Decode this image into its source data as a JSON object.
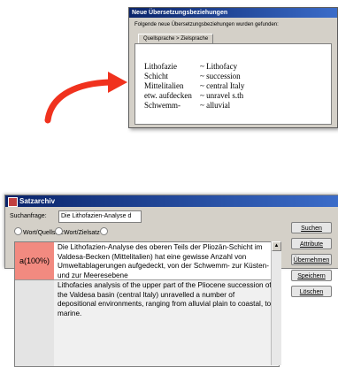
{
  "dialog": {
    "title": "Neue Übersetzungsbeziehungen",
    "message": "Folgende neue Übersetzungsbeziehungen wurden gefunden:",
    "tab": "Quellsprache > Zielsprache",
    "rows": [
      {
        "source": "Lithofazie",
        "target": "~ Lithofacy"
      },
      {
        "source": "Schicht",
        "target": "~ succession"
      },
      {
        "source": "Mittelitalien",
        "target": "~ central Italy"
      },
      {
        "source": "etw. aufdecken",
        "target": "~ unravel s.th"
      },
      {
        "source": "Schwemm-",
        "target": "~ alluvial"
      }
    ]
  },
  "window": {
    "title": "Satzarchiv",
    "search_label": "Suchanfrage:",
    "search_value": "Die Lithofazien-Analyse d",
    "radios": [
      "Wort/Quellsatz",
      "Wort/Zielsatz",
      ""
    ]
  },
  "records": [
    {
      "label": "a(100%)",
      "text": "Die Lithofazien-Analyse des oberen Teils der Pliozän-Schicht im Valdesa-Becken (Mittelitalien) hat eine gewisse Anzahl von Umweltablagerungen aufgedeckt, von der Schwemm- zur Küsten- und zur Meeresebene"
    },
    {
      "label": "",
      "text": "Lithofacies analysis of the upper part of the Pliocene succession of the Valdesa basin (central Italy) unravelled a number of depositional environments, ranging from alluvial plain to coastal, to marine."
    }
  ],
  "buttons": [
    "Suchen",
    "Attribute",
    "Übernehmen",
    "Speichern",
    "Löschen"
  ],
  "colors": {
    "accent_red": "#f0321e",
    "match_label_bg": "#f28a80",
    "titlebar": "#0a246a"
  }
}
